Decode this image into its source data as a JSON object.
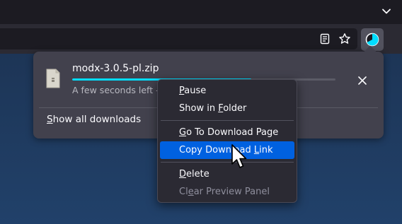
{
  "browser": {
    "icons": {
      "tab_list": "chevron-down-icon",
      "reader": "reader-view-icon",
      "bookmark": "star-icon",
      "downloads": "download-progress-icon"
    }
  },
  "downloads_panel": {
    "item": {
      "file_name": "modx-3.0.5-pl.zip",
      "status": "A few seconds left -",
      "progress_percent": 68,
      "file_icon": "zip-file-icon",
      "cancel_icon": "close-icon"
    },
    "show_all": "Show all downloads"
  },
  "context_menu": {
    "items": [
      {
        "label": "Pause",
        "state": "normal"
      },
      {
        "label": "Show in Folder",
        "state": "normal"
      },
      {
        "label": "Go To Download Page",
        "state": "normal"
      },
      {
        "label": "Copy Download Link",
        "state": "active"
      },
      {
        "label": "Delete",
        "state": "normal"
      },
      {
        "label": "Clear Preview Panel",
        "state": "disabled"
      }
    ]
  },
  "colors": {
    "accent": "#0061e0",
    "progress": "#00ddff",
    "panel_bg": "#42414d",
    "menu_bg": "#2b2a33"
  }
}
